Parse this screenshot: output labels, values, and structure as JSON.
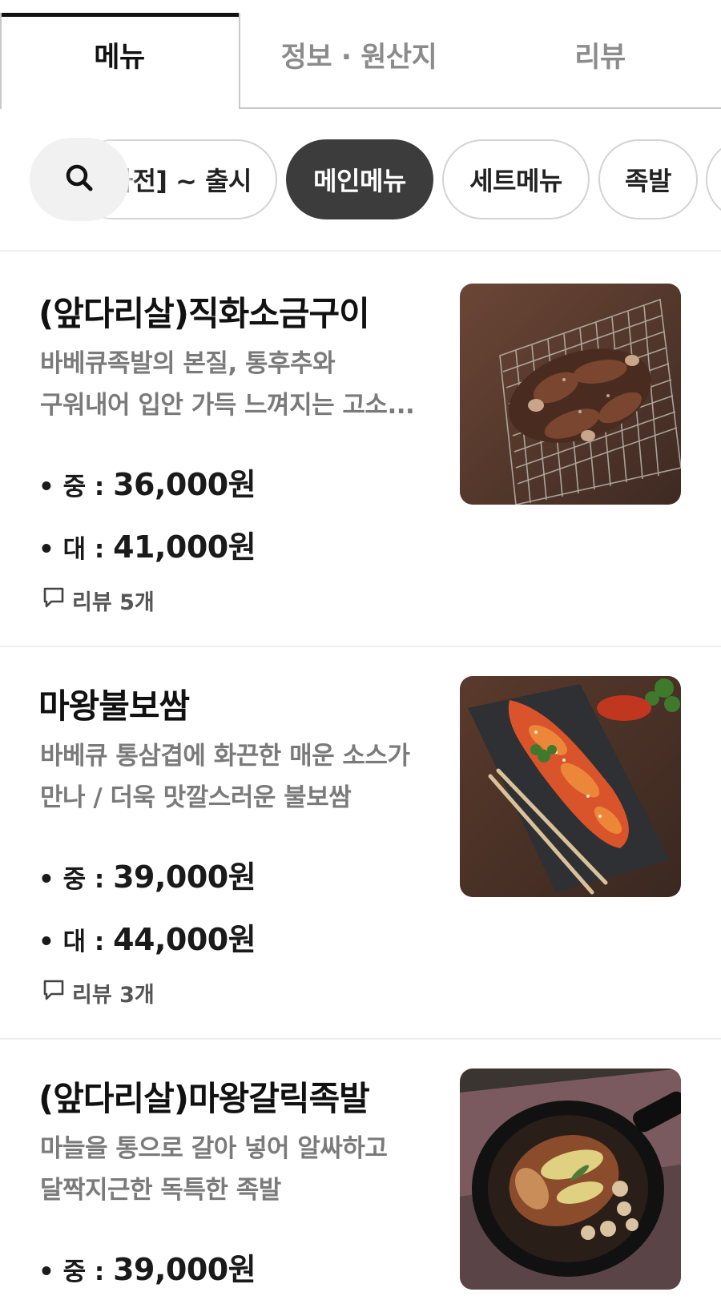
{
  "tabs": [
    {
      "label": "메뉴",
      "active": true
    },
    {
      "label": "정보 · 원산지",
      "active": false
    },
    {
      "label": "리뷰",
      "active": false
    }
  ],
  "chips": [
    {
      "label": "사전] ~ 출시",
      "clipped": true
    },
    {
      "label": "메인메뉴",
      "selected": true
    },
    {
      "label": "세트메뉴"
    },
    {
      "label": "족발"
    }
  ],
  "menu_items": [
    {
      "title": "(앞다리살)직화소금구이",
      "desc_lines": [
        "바베큐족발의 본질, 통후추와",
        "구워내어 입안 가득 느껴지는 고소..."
      ],
      "prices": [
        {
          "label": "• 중 : ",
          "value": "36,000원"
        },
        {
          "label": "• 대 : ",
          "value": "41,000원"
        }
      ],
      "review": "리뷰 5개"
    },
    {
      "title": "마왕불보쌈",
      "desc_lines": [
        "바베큐 통삼겹에 화끈한 매운 소스가",
        "만나 / 더욱 맛깔스러운 불보쌈"
      ],
      "prices": [
        {
          "label": "• 중 : ",
          "value": "39,000원"
        },
        {
          "label": "• 대 : ",
          "value": "44,000원"
        }
      ],
      "review": "리뷰 3개"
    },
    {
      "title": "(앞다리살)마왕갈릭족발",
      "desc_lines": [
        "마늘을 통으로 갈아 넣어 알싸하고",
        "달짝지근한 독특한 족발"
      ],
      "prices": [
        {
          "label": "• 중 : ",
          "value": "39,000원"
        }
      ]
    }
  ],
  "colors": {
    "active_tab_bar": "#111111",
    "chip_selected_bg": "#3c3c3c",
    "description_text": "#7a7a7a",
    "divider": "#efefef"
  },
  "icons": {
    "search": "search-icon",
    "review": "speech-bubble-icon"
  }
}
